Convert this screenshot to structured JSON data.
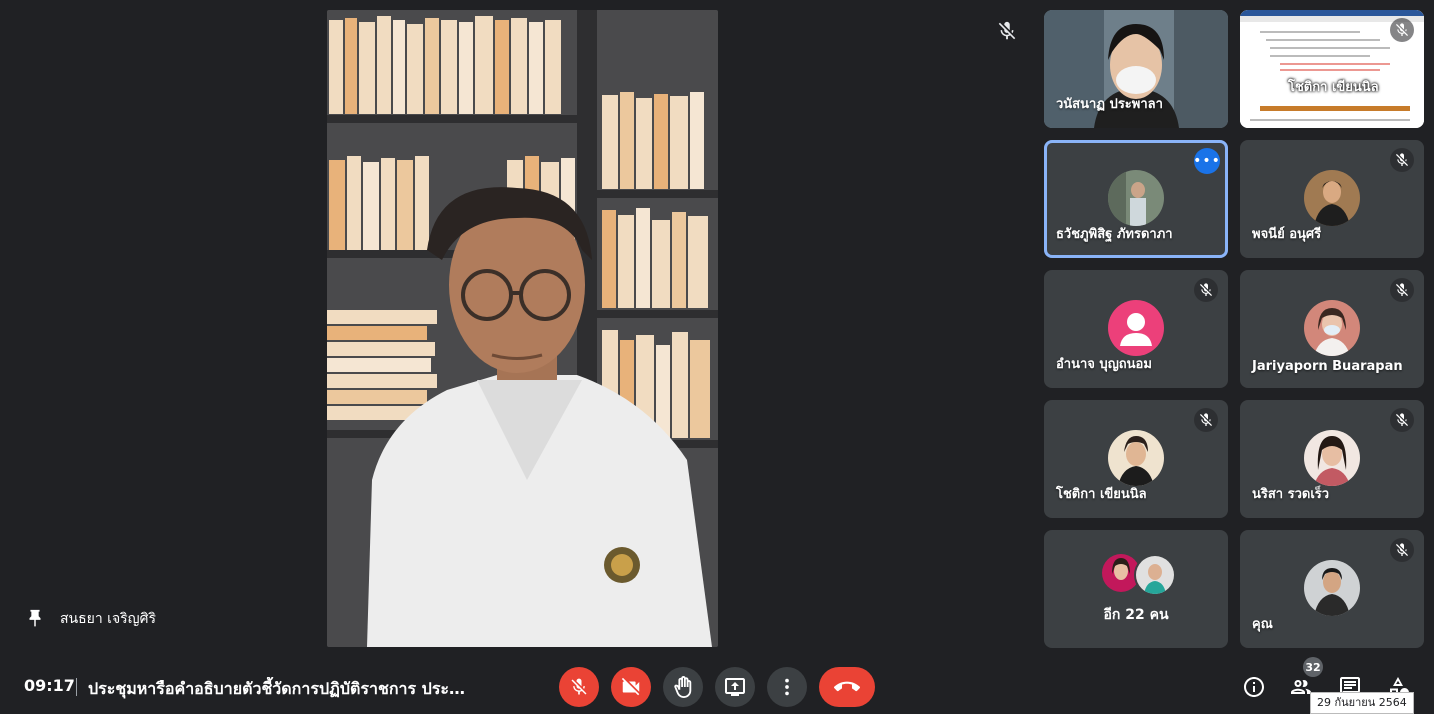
{
  "main": {
    "pinned_name": "สนธยา เจริญศิริ"
  },
  "tiles": [
    {
      "name": "วนัสนาฏ ประพาลา",
      "muted": false,
      "video": true
    },
    {
      "name": "",
      "muted": true,
      "screen_share": true,
      "share_text": "โชติกา เขียนนิล"
    },
    {
      "name": "ธวัชภูพิสิฐ ภัทรดาภา",
      "muted": false,
      "active": true
    },
    {
      "name": "พจนีย์ อนุศรี",
      "muted": true
    },
    {
      "name": "อำนาจ บุญถนอม",
      "muted": true
    },
    {
      "name": "Jariyaporn Buarapan",
      "muted": true
    },
    {
      "name": "โชติกา เขียนนิล",
      "muted": true
    },
    {
      "name": "นริสา รวดเร็ว",
      "muted": true
    },
    {
      "name": "อีก 22 คน",
      "muted": false
    },
    {
      "name": "คุณ",
      "muted": true
    }
  ],
  "bottom": {
    "time": "09:17",
    "title": "ประชุมหารือคำอธิบายตัวชี้วัดการปฏิบัติราชการ ประจำปีงบประมาณ",
    "participants_count": "32",
    "tooltip": "29 กันยายน 2564"
  },
  "colors": {
    "background": "#202124",
    "tile": "#3c4043",
    "red": "#ea4335",
    "active_outline": "#8ab4f8",
    "more_button": "#1a73e8"
  },
  "icons": [
    "pin-icon",
    "mic-off-icon",
    "more-icon",
    "videocam-off-icon",
    "hand-icon",
    "present-icon",
    "more-vert-icon",
    "call-end-icon",
    "info-icon",
    "people-icon",
    "chat-icon",
    "activities-icon",
    "person-icon"
  ]
}
